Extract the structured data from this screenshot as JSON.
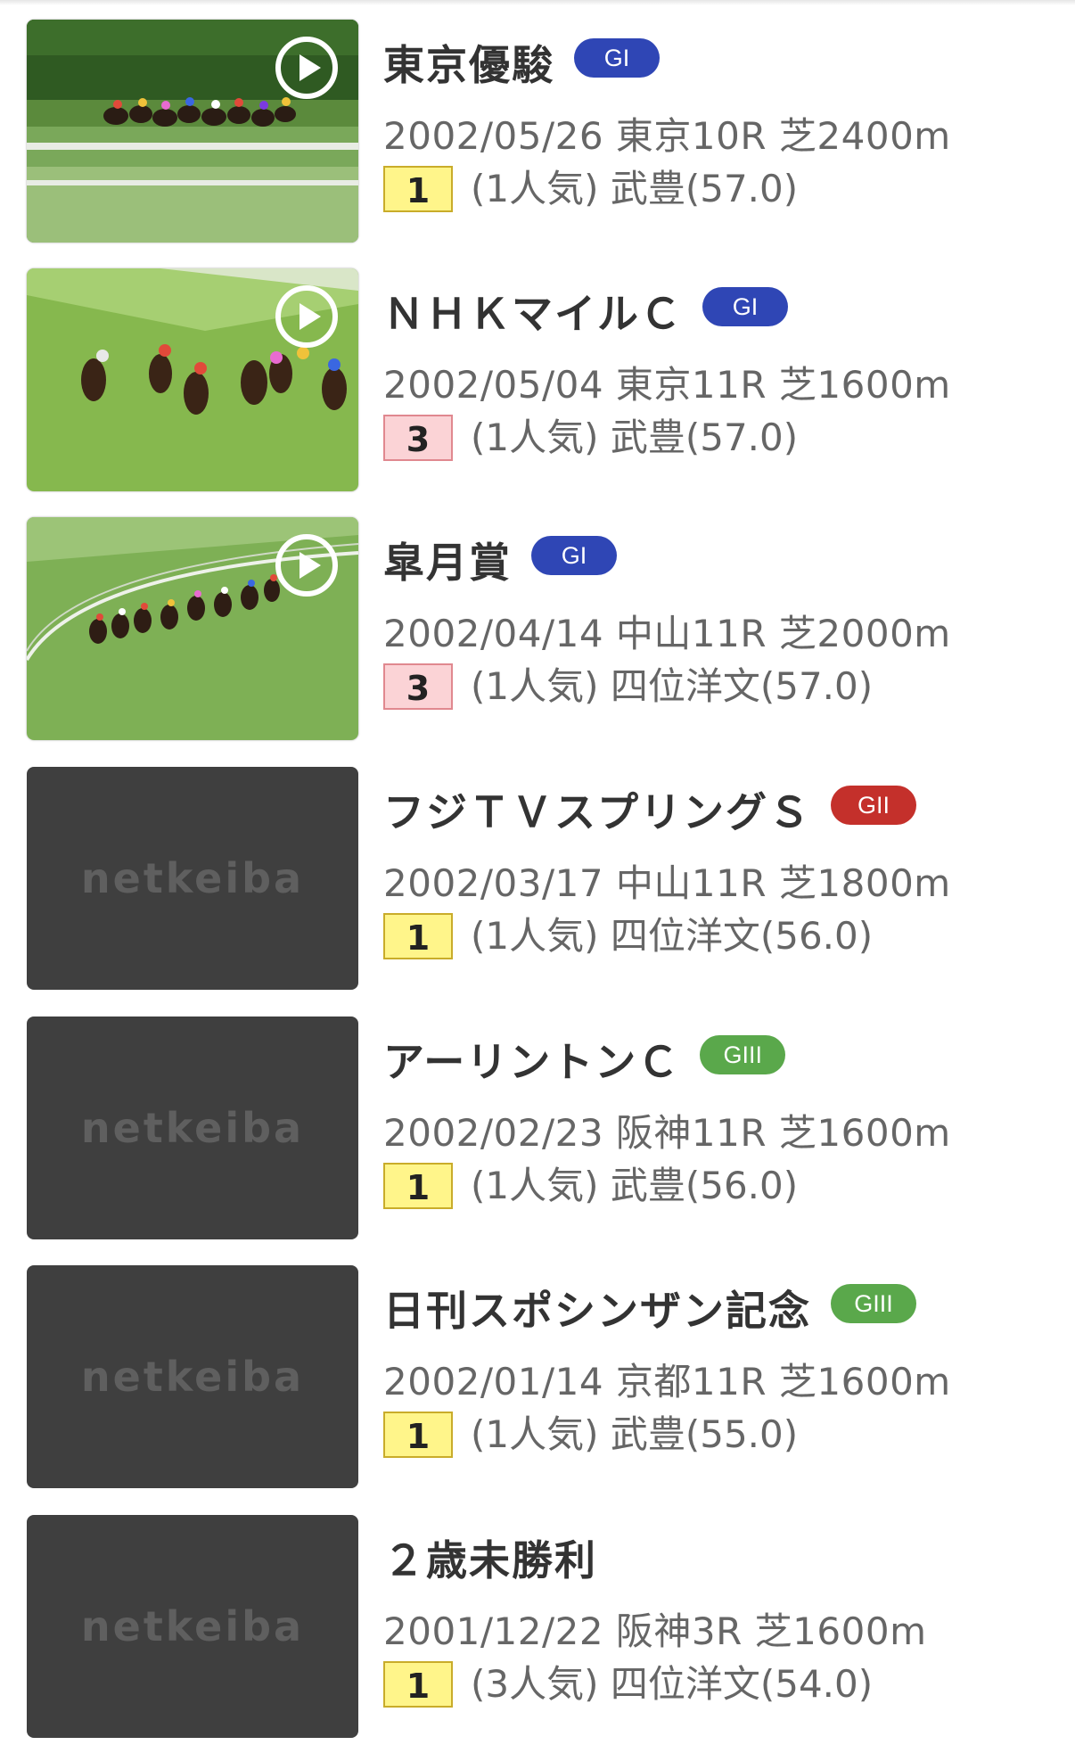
{
  "colors": {
    "grade_g1": "#2f46b5",
    "grade_g2": "#c4302b",
    "grade_g3": "#5aa84b",
    "placeholder_bg": "#3f3f3f",
    "rank_win_bg": "#fff58a",
    "rank_place_bg": "#fbd3d6"
  },
  "placeholder_logo": "netkeiba",
  "races": [
    {
      "name": "東京優駿",
      "grade": "GI",
      "grade_color": "#2f46b5",
      "detail": "2002/05/26 東京10R 芝2400m",
      "rank": "1",
      "rank_type": "win",
      "result": "(1人気) 武豊(57.0)",
      "thumbnail": "race-video",
      "has_video": true
    },
    {
      "name": "ＮＨＫマイルＣ",
      "grade": "GI",
      "grade_color": "#2f46b5",
      "detail": "2002/05/04 東京11R 芝1600m",
      "rank": "3",
      "rank_type": "place",
      "result": "(1人気) 武豊(57.0)",
      "thumbnail": "race-video",
      "has_video": true
    },
    {
      "name": "皐月賞",
      "grade": "GI",
      "grade_color": "#2f46b5",
      "detail": "2002/04/14 中山11R 芝2000m",
      "rank": "3",
      "rank_type": "place",
      "result": "(1人気) 四位洋文(57.0)",
      "thumbnail": "race-video",
      "has_video": true
    },
    {
      "name": "フジＴＶスプリングＳ",
      "grade": "GII",
      "grade_color": "#c4302b",
      "detail": "2002/03/17 中山11R 芝1800m",
      "rank": "1",
      "rank_type": "win",
      "result": "(1人気) 四位洋文(56.0)",
      "thumbnail": "placeholder",
      "has_video": false
    },
    {
      "name": "アーリントンＣ",
      "grade": "GIII",
      "grade_color": "#5aa84b",
      "detail": "2002/02/23 阪神11R 芝1600m",
      "rank": "1",
      "rank_type": "win",
      "result": "(1人気) 武豊(56.0)",
      "thumbnail": "placeholder",
      "has_video": false
    },
    {
      "name": "日刊スポシンザン記念",
      "grade": "GIII",
      "grade_color": "#5aa84b",
      "detail": "2002/01/14 京都11R 芝1600m",
      "rank": "1",
      "rank_type": "win",
      "result": "(1人気) 武豊(55.0)",
      "thumbnail": "placeholder",
      "has_video": false
    },
    {
      "name": "２歳未勝利",
      "grade": "",
      "grade_color": "",
      "detail": "2001/12/22 阪神3R 芝1600m",
      "rank": "1",
      "rank_type": "win",
      "result": "(3人気) 四位洋文(54.0)",
      "thumbnail": "placeholder",
      "has_video": false
    }
  ]
}
